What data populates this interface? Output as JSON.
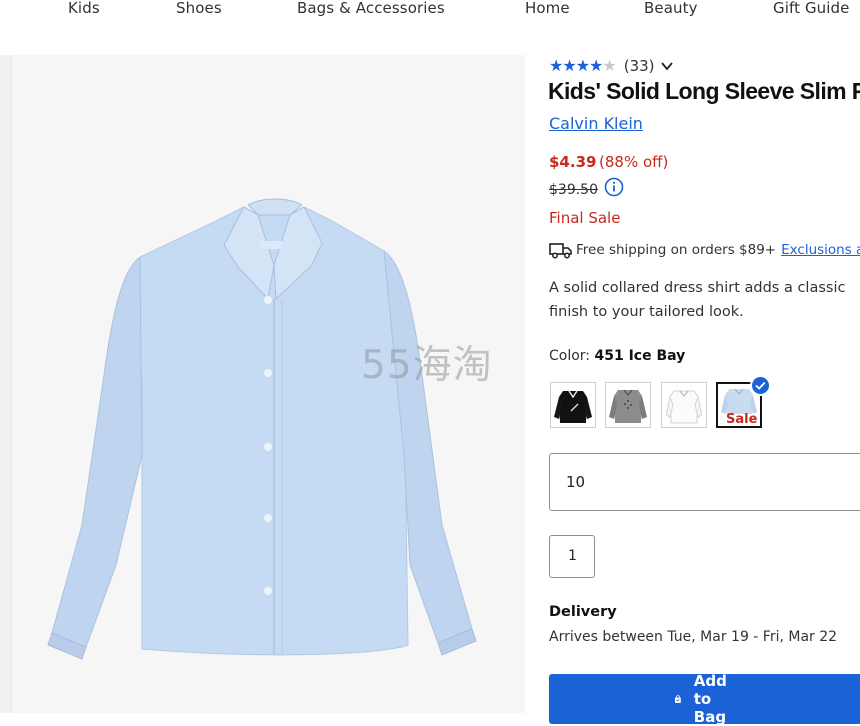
{
  "nav": {
    "items": [
      "Kids",
      "Shoes",
      "Bags & Accessories",
      "Home",
      "Beauty",
      "Gift Guide"
    ]
  },
  "product": {
    "rating": {
      "stars": 4,
      "count_text": "(33)"
    },
    "title": "Kids' Solid Long Sleeve Slim F",
    "brand": "Calvin Klein",
    "price": "$4.39",
    "discount": "(88% off)",
    "original_price": "$39.50",
    "final_sale": "Final Sale",
    "shipping_text": "Free shipping on orders $89+",
    "shipping_link": "Exclusions a",
    "description": "A solid collared dress shirt adds a classic finish to your tailored look.",
    "color_label": "Color:",
    "color_value": "451 Ice Bay",
    "swatches": [
      {
        "name": "black",
        "color": "#111111"
      },
      {
        "name": "grey",
        "color": "#8c8c8c"
      },
      {
        "name": "white",
        "color": "#ffffff"
      },
      {
        "name": "ice-bay",
        "color": "#c8dbf1",
        "badge": "Sale",
        "selected": true
      }
    ],
    "size": "10",
    "quantity": "1",
    "delivery_heading": "Delivery",
    "delivery_text": "Arrives between Tue, Mar 19 - Fri, Mar 22",
    "add_to_bag": "Add to Bag"
  },
  "watermark": "55海淘",
  "colors": {
    "accent": "#1a62d6",
    "sale": "#c8291c",
    "shirt": "#c3d8f2"
  }
}
